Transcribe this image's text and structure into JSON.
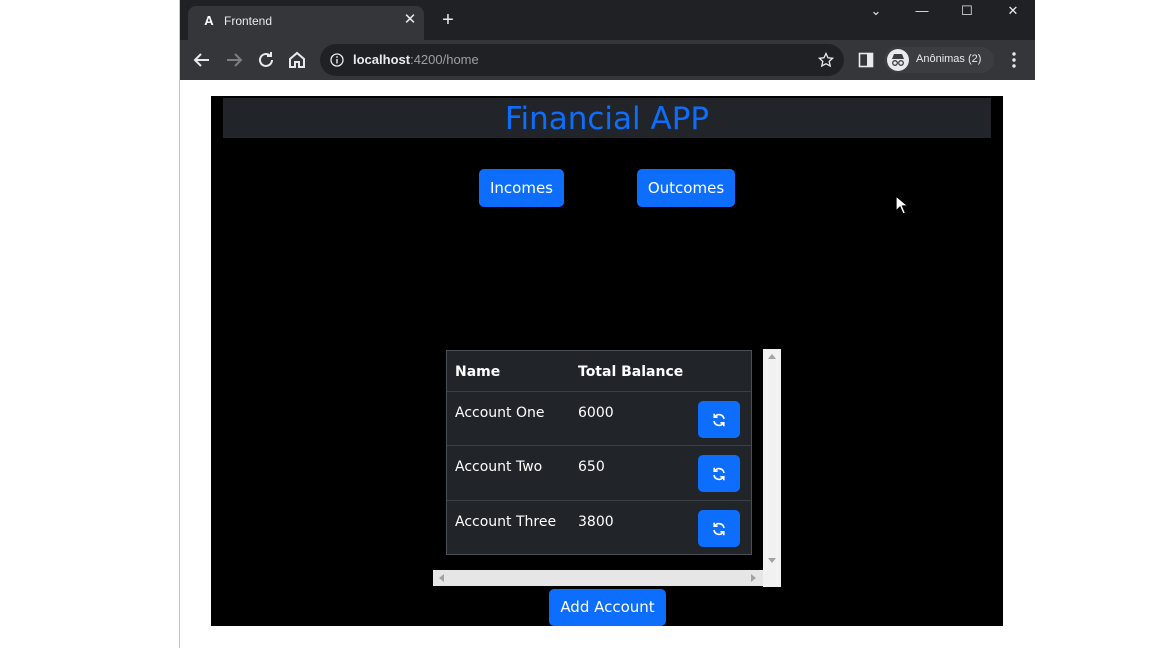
{
  "browser": {
    "tab_title": "Frontend",
    "tab_favicon": "A",
    "tab_close": "✕",
    "new_tab": "+",
    "url_host": "localhost",
    "url_rest": ":4200/home",
    "profile_label": "Anônimas (2)",
    "window_controls": {
      "dropdown": "⌄",
      "minimize": "—",
      "maximize": "☐",
      "close": "✕"
    }
  },
  "app": {
    "title": "Financial APP",
    "incomes_label": "Incomes",
    "outcomes_label": "Outcomes",
    "table": {
      "columns": [
        "Name",
        "Total Balance"
      ],
      "rows": [
        {
          "name": "Account One",
          "balance": "6000"
        },
        {
          "name": "Account Two",
          "balance": "650"
        },
        {
          "name": "Account Three",
          "balance": "3800"
        }
      ]
    },
    "add_account_label": "Add Account"
  },
  "colors": {
    "accent": "#0d6efd",
    "app_background": "#000000",
    "table_background": "#212529"
  },
  "icons": [
    "back-icon",
    "forward-icon",
    "reload-icon",
    "home-icon",
    "info-icon",
    "star-icon",
    "side-panel-icon",
    "incognito-icon",
    "menu-icon",
    "refresh-icon",
    "mouse-pointer-icon"
  ]
}
